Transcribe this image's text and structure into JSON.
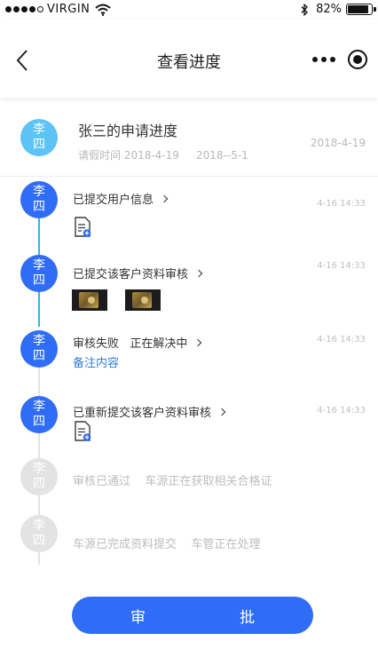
{
  "status_bar": {
    "carrier": "VIRGIN",
    "battery": "82%",
    "battery_level": 0.82
  },
  "nav": {
    "title": "查看进度"
  },
  "summary": {
    "avatar_text": "李四",
    "title": "张三的申请进度",
    "subtitle": "请假时间 2018-4-19     2018--5-1",
    "date": "2018-4-19"
  },
  "steps": [
    {
      "avatar": "李四",
      "title": "已提交用户信息",
      "time": "4-16 14:33",
      "status": "done"
    },
    {
      "avatar": "李四",
      "title": "已提交该客户资料审核",
      "time": "4-16 14:33",
      "status": "done"
    },
    {
      "avatar": "李四",
      "title": "审核失败   正在解决中",
      "time": "4-16 14:33",
      "note": "备注内容",
      "status": "done"
    },
    {
      "avatar": "李四",
      "title": "已重新提交该客户资料审核",
      "time": "4-16 14:33",
      "status": "done"
    },
    {
      "avatar": "李四",
      "title": "审核已通过    车源正在获取相关合格证",
      "status": "pending"
    },
    {
      "avatar": "李四",
      "title": "车源已完成资料提交    车管正在处理",
      "status": "pending"
    }
  ],
  "approve_button": {
    "left": "审",
    "right": "批"
  },
  "colors": {
    "primary": "#2f6df6",
    "line_done": "#2fb5e8",
    "line_pending": "#e3e3e3",
    "summary_avatar": "#5bc3f5",
    "note": "#2f7fd6"
  }
}
